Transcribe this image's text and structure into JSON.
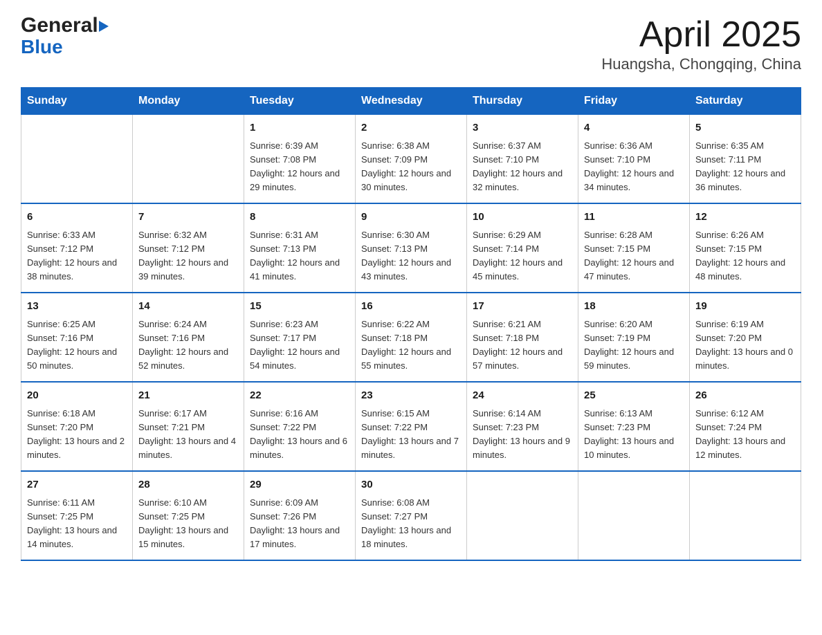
{
  "header": {
    "month_year": "April 2025",
    "location": "Huangsha, Chongqing, China",
    "logo_general": "General",
    "logo_blue": "Blue"
  },
  "weekdays": [
    "Sunday",
    "Monday",
    "Tuesday",
    "Wednesday",
    "Thursday",
    "Friday",
    "Saturday"
  ],
  "weeks": [
    [
      {
        "day": "",
        "sunrise": "",
        "sunset": "",
        "daylight": ""
      },
      {
        "day": "",
        "sunrise": "",
        "sunset": "",
        "daylight": ""
      },
      {
        "day": "1",
        "sunrise": "Sunrise: 6:39 AM",
        "sunset": "Sunset: 7:08 PM",
        "daylight": "Daylight: 12 hours and 29 minutes."
      },
      {
        "day": "2",
        "sunrise": "Sunrise: 6:38 AM",
        "sunset": "Sunset: 7:09 PM",
        "daylight": "Daylight: 12 hours and 30 minutes."
      },
      {
        "day": "3",
        "sunrise": "Sunrise: 6:37 AM",
        "sunset": "Sunset: 7:10 PM",
        "daylight": "Daylight: 12 hours and 32 minutes."
      },
      {
        "day": "4",
        "sunrise": "Sunrise: 6:36 AM",
        "sunset": "Sunset: 7:10 PM",
        "daylight": "Daylight: 12 hours and 34 minutes."
      },
      {
        "day": "5",
        "sunrise": "Sunrise: 6:35 AM",
        "sunset": "Sunset: 7:11 PM",
        "daylight": "Daylight: 12 hours and 36 minutes."
      }
    ],
    [
      {
        "day": "6",
        "sunrise": "Sunrise: 6:33 AM",
        "sunset": "Sunset: 7:12 PM",
        "daylight": "Daylight: 12 hours and 38 minutes."
      },
      {
        "day": "7",
        "sunrise": "Sunrise: 6:32 AM",
        "sunset": "Sunset: 7:12 PM",
        "daylight": "Daylight: 12 hours and 39 minutes."
      },
      {
        "day": "8",
        "sunrise": "Sunrise: 6:31 AM",
        "sunset": "Sunset: 7:13 PM",
        "daylight": "Daylight: 12 hours and 41 minutes."
      },
      {
        "day": "9",
        "sunrise": "Sunrise: 6:30 AM",
        "sunset": "Sunset: 7:13 PM",
        "daylight": "Daylight: 12 hours and 43 minutes."
      },
      {
        "day": "10",
        "sunrise": "Sunrise: 6:29 AM",
        "sunset": "Sunset: 7:14 PM",
        "daylight": "Daylight: 12 hours and 45 minutes."
      },
      {
        "day": "11",
        "sunrise": "Sunrise: 6:28 AM",
        "sunset": "Sunset: 7:15 PM",
        "daylight": "Daylight: 12 hours and 47 minutes."
      },
      {
        "day": "12",
        "sunrise": "Sunrise: 6:26 AM",
        "sunset": "Sunset: 7:15 PM",
        "daylight": "Daylight: 12 hours and 48 minutes."
      }
    ],
    [
      {
        "day": "13",
        "sunrise": "Sunrise: 6:25 AM",
        "sunset": "Sunset: 7:16 PM",
        "daylight": "Daylight: 12 hours and 50 minutes."
      },
      {
        "day": "14",
        "sunrise": "Sunrise: 6:24 AM",
        "sunset": "Sunset: 7:16 PM",
        "daylight": "Daylight: 12 hours and 52 minutes."
      },
      {
        "day": "15",
        "sunrise": "Sunrise: 6:23 AM",
        "sunset": "Sunset: 7:17 PM",
        "daylight": "Daylight: 12 hours and 54 minutes."
      },
      {
        "day": "16",
        "sunrise": "Sunrise: 6:22 AM",
        "sunset": "Sunset: 7:18 PM",
        "daylight": "Daylight: 12 hours and 55 minutes."
      },
      {
        "day": "17",
        "sunrise": "Sunrise: 6:21 AM",
        "sunset": "Sunset: 7:18 PM",
        "daylight": "Daylight: 12 hours and 57 minutes."
      },
      {
        "day": "18",
        "sunrise": "Sunrise: 6:20 AM",
        "sunset": "Sunset: 7:19 PM",
        "daylight": "Daylight: 12 hours and 59 minutes."
      },
      {
        "day": "19",
        "sunrise": "Sunrise: 6:19 AM",
        "sunset": "Sunset: 7:20 PM",
        "daylight": "Daylight: 13 hours and 0 minutes."
      }
    ],
    [
      {
        "day": "20",
        "sunrise": "Sunrise: 6:18 AM",
        "sunset": "Sunset: 7:20 PM",
        "daylight": "Daylight: 13 hours and 2 minutes."
      },
      {
        "day": "21",
        "sunrise": "Sunrise: 6:17 AM",
        "sunset": "Sunset: 7:21 PM",
        "daylight": "Daylight: 13 hours and 4 minutes."
      },
      {
        "day": "22",
        "sunrise": "Sunrise: 6:16 AM",
        "sunset": "Sunset: 7:22 PM",
        "daylight": "Daylight: 13 hours and 6 minutes."
      },
      {
        "day": "23",
        "sunrise": "Sunrise: 6:15 AM",
        "sunset": "Sunset: 7:22 PM",
        "daylight": "Daylight: 13 hours and 7 minutes."
      },
      {
        "day": "24",
        "sunrise": "Sunrise: 6:14 AM",
        "sunset": "Sunset: 7:23 PM",
        "daylight": "Daylight: 13 hours and 9 minutes."
      },
      {
        "day": "25",
        "sunrise": "Sunrise: 6:13 AM",
        "sunset": "Sunset: 7:23 PM",
        "daylight": "Daylight: 13 hours and 10 minutes."
      },
      {
        "day": "26",
        "sunrise": "Sunrise: 6:12 AM",
        "sunset": "Sunset: 7:24 PM",
        "daylight": "Daylight: 13 hours and 12 minutes."
      }
    ],
    [
      {
        "day": "27",
        "sunrise": "Sunrise: 6:11 AM",
        "sunset": "Sunset: 7:25 PM",
        "daylight": "Daylight: 13 hours and 14 minutes."
      },
      {
        "day": "28",
        "sunrise": "Sunrise: 6:10 AM",
        "sunset": "Sunset: 7:25 PM",
        "daylight": "Daylight: 13 hours and 15 minutes."
      },
      {
        "day": "29",
        "sunrise": "Sunrise: 6:09 AM",
        "sunset": "Sunset: 7:26 PM",
        "daylight": "Daylight: 13 hours and 17 minutes."
      },
      {
        "day": "30",
        "sunrise": "Sunrise: 6:08 AM",
        "sunset": "Sunset: 7:27 PM",
        "daylight": "Daylight: 13 hours and 18 minutes."
      },
      {
        "day": "",
        "sunrise": "",
        "sunset": "",
        "daylight": ""
      },
      {
        "day": "",
        "sunrise": "",
        "sunset": "",
        "daylight": ""
      },
      {
        "day": "",
        "sunrise": "",
        "sunset": "",
        "daylight": ""
      }
    ]
  ]
}
